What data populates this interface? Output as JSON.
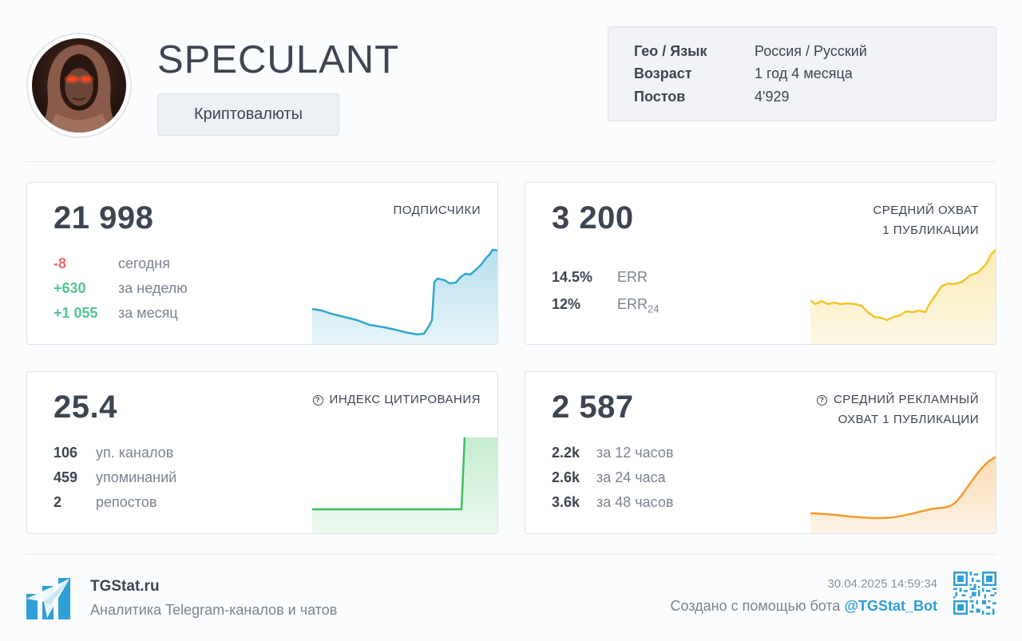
{
  "channel": {
    "name": "SPECULANT",
    "category": "Криптовалюты",
    "avatar_icon": "hooded-figure-glowing-eyes-avatar"
  },
  "info": {
    "rows": [
      {
        "key": "Гео / Язык",
        "value": "Россия / Русский"
      },
      {
        "key": "Возраст",
        "value": "1 год 4 месяца"
      },
      {
        "key": "Постов",
        "value": "4'929"
      }
    ]
  },
  "cards": {
    "subscribers": {
      "value": "21 998",
      "label": "ПОДПИСЧИКИ",
      "stats": [
        {
          "num": "-8",
          "text": "сегодня"
        },
        {
          "num": "+630",
          "text": "за неделю"
        },
        {
          "num": "+1 055",
          "text": "за месяц"
        }
      ],
      "color": "#32a6cf"
    },
    "reach": {
      "value": "3 200",
      "label_line1": "СРЕДНИЙ ОХВАТ",
      "label_line2": "1 ПУБЛИКАЦИИ",
      "stats": [
        {
          "num": "14.5%",
          "text": "ERR"
        },
        {
          "num": "12%",
          "text": "ERR",
          "sub": "24"
        }
      ],
      "color": "#f3c52c"
    },
    "citation": {
      "value": "25.4",
      "label": "ИНДЕКС ЦИТИРОВАНИЯ",
      "stats": [
        {
          "num": "106",
          "text": "уп. каналов"
        },
        {
          "num": "459",
          "text": "упоминаний"
        },
        {
          "num": "2",
          "text": "репостов"
        }
      ],
      "color": "#3cbf5e"
    },
    "ad_reach": {
      "value": "2 587",
      "label_line1": "СРЕДНИЙ РЕКЛАМНЫЙ",
      "label_line2": "ОХВАТ 1 ПУБЛИКАЦИИ",
      "stats": [
        {
          "num": "2.2k",
          "text": "за 12 часов"
        },
        {
          "num": "2.6k",
          "text": "за 24 часа"
        },
        {
          "num": "3.6k",
          "text": "за 48 часов"
        }
      ],
      "color": "#f59a2a"
    }
  },
  "footer": {
    "brand": "TGStat.ru",
    "tagline": "Аналитика Telegram-каналов и чатов",
    "timestamp": "30.04.2025 14:59:34",
    "credit_text": "Создано с помощью бота ",
    "bot_link": "@TGStat_Bot"
  }
}
